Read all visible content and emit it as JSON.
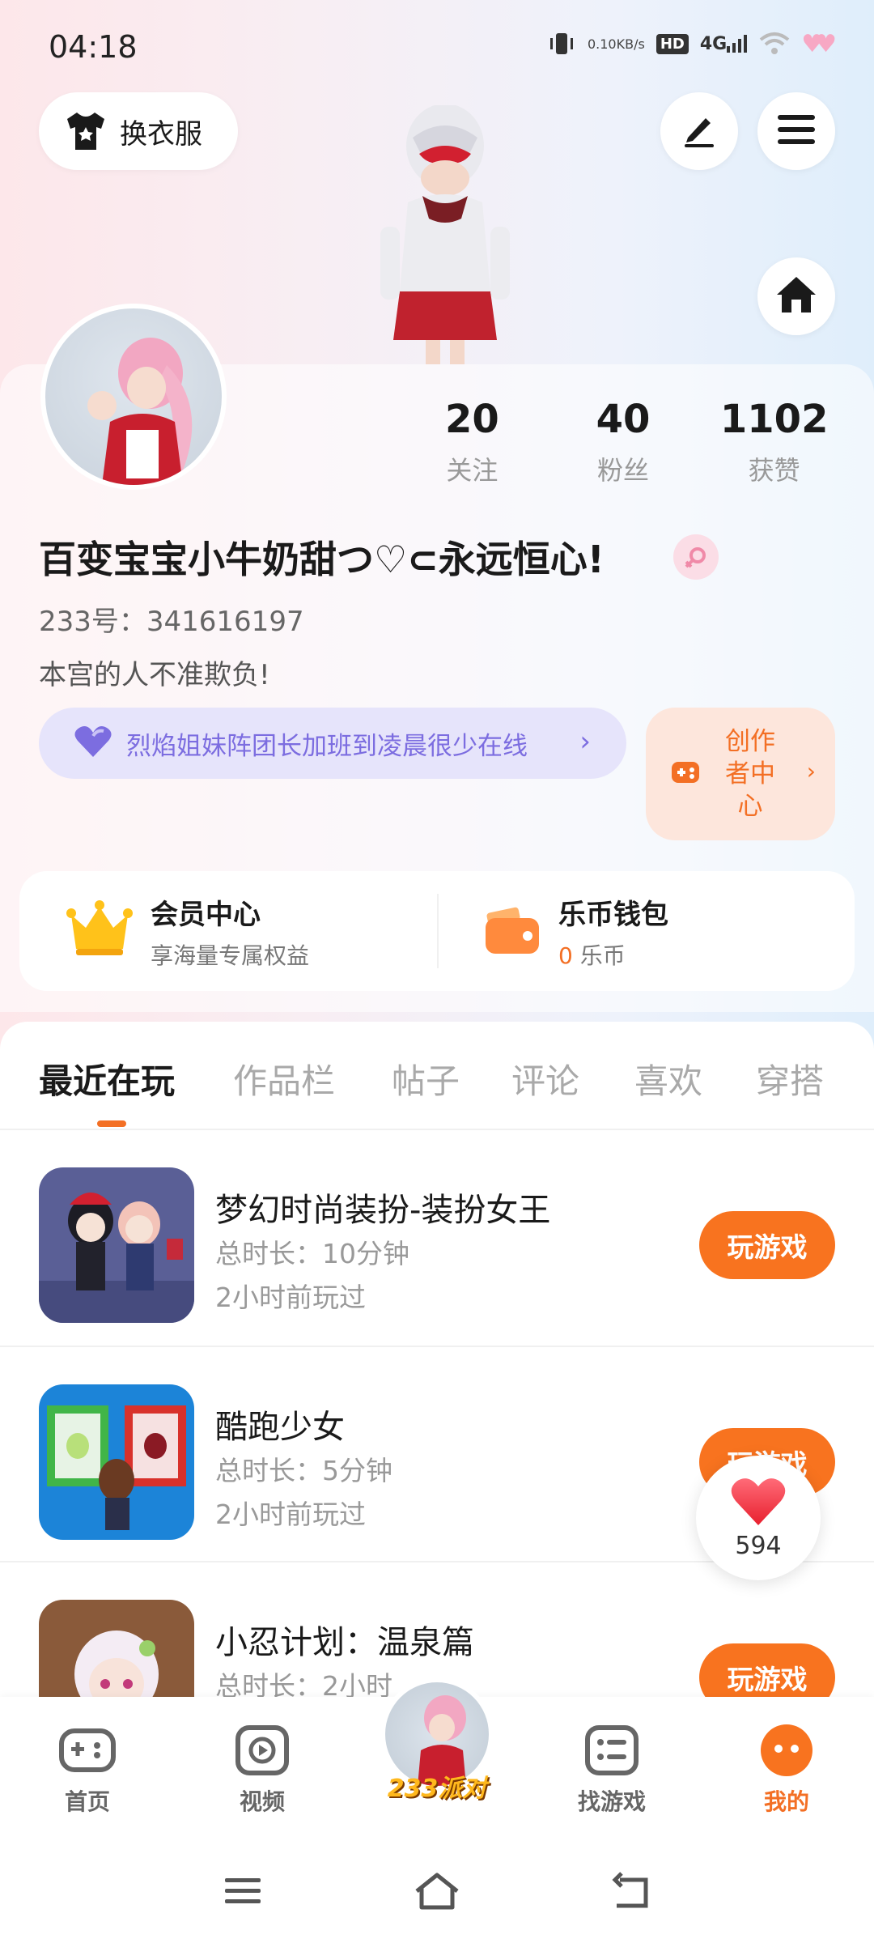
{
  "status_bar": {
    "time": "04:18",
    "speed_top": "0.10",
    "speed_unit": "KB/s",
    "hd_label": "HD",
    "network": "4G"
  },
  "header": {
    "outfit_label": "换衣服",
    "icons": [
      "shirt-icon",
      "edit-icon",
      "menu-icon",
      "home-icon"
    ]
  },
  "profile": {
    "stats": [
      {
        "value": "20",
        "label": "关注"
      },
      {
        "value": "40",
        "label": "粉丝"
      },
      {
        "value": "1102",
        "label": "获赞"
      }
    ],
    "nickname": "百变宝宝小牛奶甜つ♡⊂永远恒心!",
    "uid": "233号：341616197",
    "bio": "本宫的人不准欺负!",
    "family_text": "烈焰姐妹阵团长加班到凌晨很少在线",
    "creator_label": "创作者中心"
  },
  "cards": {
    "vip_title": "会员中心",
    "vip_sub": "享海量专属权益",
    "wallet_title": "乐币钱包",
    "wallet_amount": "0",
    "wallet_unit": "乐币"
  },
  "tabs": [
    "最近在玩",
    "作品栏",
    "帖子",
    "评论",
    "喜欢",
    "穿搭"
  ],
  "games": [
    {
      "title": "梦幻时尚装扮-装扮女王",
      "duration": "总时长：10分钟",
      "last_played": "2小时前玩过",
      "button": "玩游戏"
    },
    {
      "title": "酷跑少女",
      "duration": "总时长：5分钟",
      "last_played": "2小时前玩过",
      "button": "玩游戏"
    },
    {
      "title": "小忍计划：温泉篇",
      "duration": "总时长：2小时",
      "last_played": "",
      "button": "玩游戏"
    }
  ],
  "like_float": {
    "count": "594"
  },
  "bottom_nav": {
    "items": [
      {
        "label": "首页",
        "icon": "gamepad-icon"
      },
      {
        "label": "视频",
        "icon": "video-play-icon"
      },
      {
        "label": "233派对",
        "icon": "party-avatar"
      },
      {
        "label": "找游戏",
        "icon": "find-game-icon"
      },
      {
        "label": "我的",
        "icon": "me-icon"
      }
    ],
    "active_index": 4
  },
  "colors": {
    "accent": "#f36f24",
    "play_button": "#f8731f",
    "family_purple": "#7c6de0"
  }
}
